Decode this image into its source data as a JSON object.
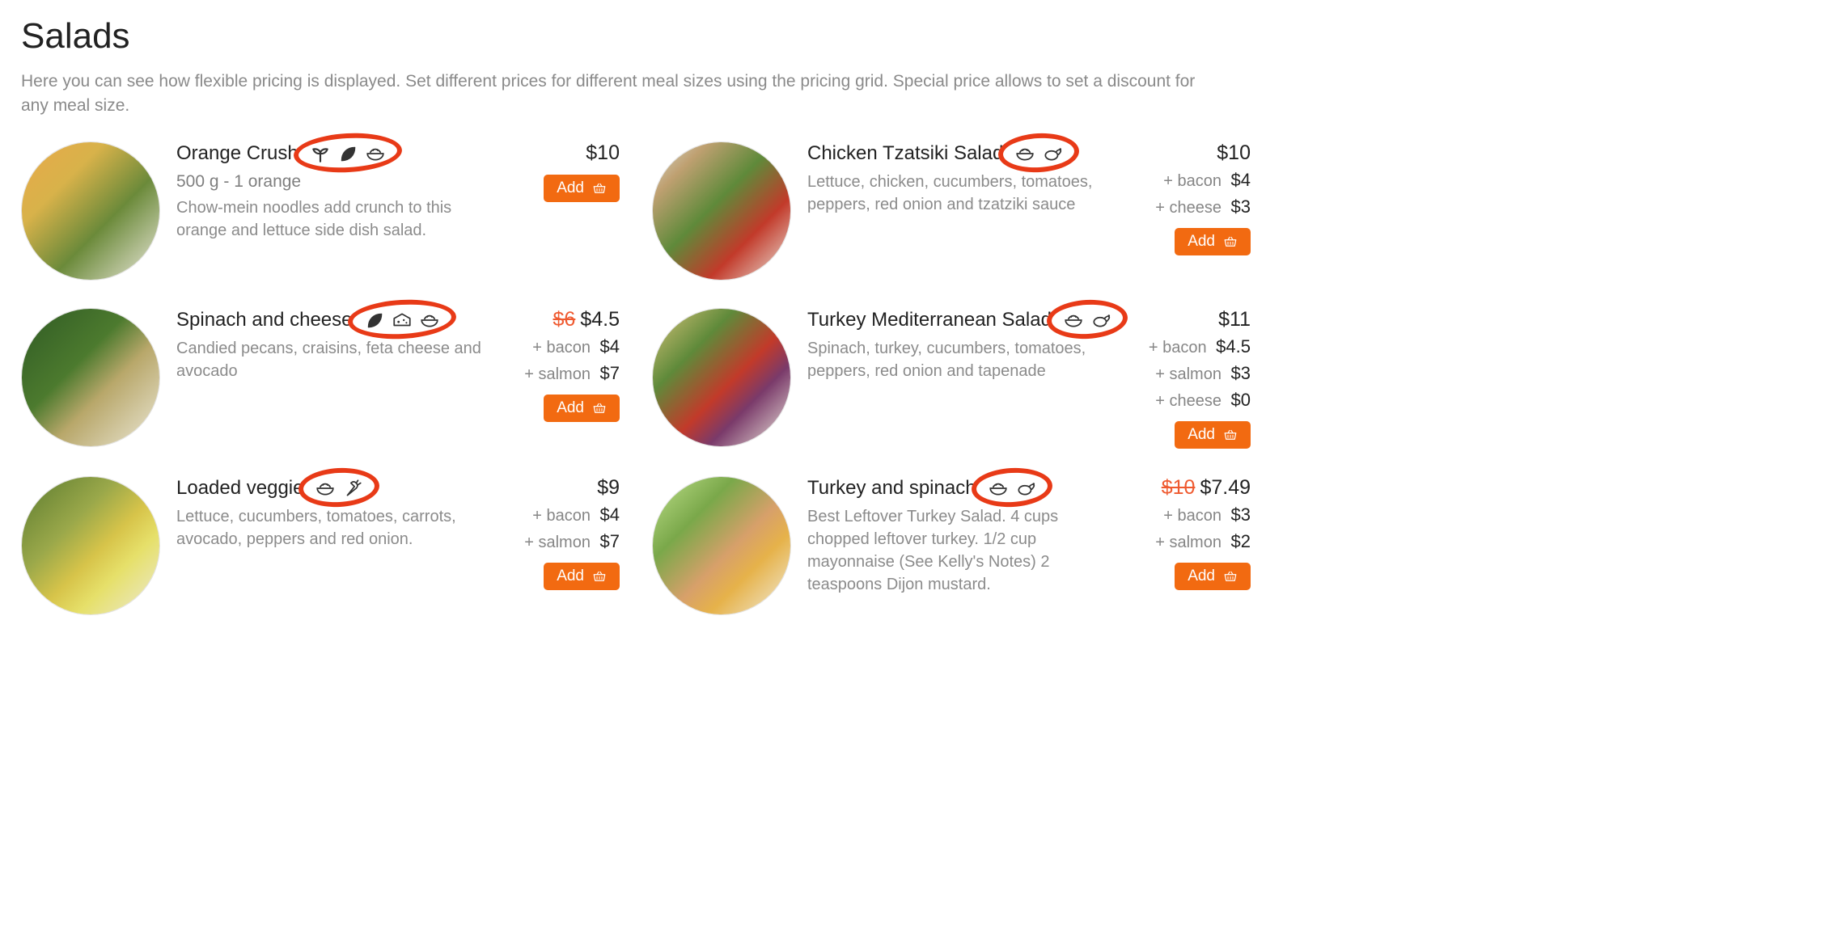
{
  "section": {
    "title": "Salads",
    "description": "Here you can see how flexible pricing is displayed. Set different prices for different meal sizes using the pricing grid. Special price allows to set a discount for any meal size."
  },
  "icons": {
    "sprout": "sprout-icon",
    "leaf": "leaf-icon",
    "bowl": "bowl-icon",
    "cheese": "cheese-icon",
    "carrot": "carrot-icon",
    "poultry": "poultry-icon"
  },
  "add_label": "Add",
  "items": [
    {
      "id": "orange-crush",
      "name": "Orange Crush",
      "desc": "Chow-mein noodles add crunch to this orange and lettuce side dish salad.",
      "icons": [
        "sprout",
        "leaf",
        "bowl"
      ],
      "note": "500 g - 1 orange",
      "price": "$10",
      "old_price": "",
      "addons": [],
      "swatch": "linear-gradient(135deg,#e9a94a 0%,#d8b24a 30%,#6b8a3a 60%,#eeeade 100%)"
    },
    {
      "id": "chicken-tzatsiki",
      "name": "Chicken Tzatsiki Salad",
      "desc": "Lettuce, chicken, cucumbers, tomatoes, peppers, red onion and tzatziki sauce",
      "icons": [
        "bowl",
        "poultry"
      ],
      "note": "",
      "price": "$10",
      "old_price": "",
      "addons": [
        {
          "label": "+ bacon",
          "price": "$4"
        },
        {
          "label": "+ cheese",
          "price": "$3"
        }
      ],
      "swatch": "linear-gradient(135deg,#d7dbcf 0%,#bfa071 20%,#5f8a3a 45%,#c23a2a 70%,#ecebe2 100%)"
    },
    {
      "id": "spinach-cheese",
      "name": "Spinach and cheese",
      "desc": "Candied pecans, craisins, feta cheese and avocado",
      "icons": [
        "leaf",
        "cheese",
        "bowl"
      ],
      "note": "",
      "price": "$4.5",
      "old_price": "$6",
      "addons": [
        {
          "label": "+ bacon",
          "price": "$4"
        },
        {
          "label": "+ salmon",
          "price": "$7"
        }
      ],
      "swatch": "linear-gradient(135deg,#2f5a24 0%,#4c7a2e 40%,#b8a76a 60%,#ece9d8 100%)"
    },
    {
      "id": "turkey-mediterranean",
      "name": "Turkey Mediterranean Salad",
      "desc": "Spinach, turkey, cucumbers, tomatoes, peppers, red onion and tapenade",
      "icons": [
        "bowl",
        "poultry"
      ],
      "note": "",
      "price": "$11",
      "old_price": "",
      "addons": [
        {
          "label": "+ bacon",
          "price": "$4.5"
        },
        {
          "label": "+ salmon",
          "price": "$3"
        },
        {
          "label": "+ cheese",
          "price": "$0"
        }
      ],
      "swatch": "linear-gradient(135deg,#d9c47a 0%,#5f8a3a 30%,#c23a2a 55%,#7a3a6a 70%,#f1eee0 100%)"
    },
    {
      "id": "loaded-veggie",
      "name": "Loaded veggie",
      "desc": "Lettuce, cucumbers, tomatoes, carrots, avocado, peppers and red onion.",
      "icons": [
        "bowl",
        "carrot"
      ],
      "note": "",
      "price": "$9",
      "old_price": "",
      "addons": [
        {
          "label": "+ bacon",
          "price": "$4"
        },
        {
          "label": "+ salmon",
          "price": "$7"
        }
      ],
      "swatch": "linear-gradient(135deg,#5a7a2e 0%,#9aa84a 35%,#d7c44a 55%,#e6e06a 70%,#ece9d8 100%)"
    },
    {
      "id": "turkey-spinach",
      "name": "Turkey and spinach",
      "desc": "Best Leftover Turkey Salad. 4 cups chopped leftover turkey. 1/2 cup mayonnaise (See Kelly's Notes) 2 teaspoons Dijon mustard.",
      "icons": [
        "bowl",
        "poultry"
      ],
      "note": "",
      "price": "$7.49",
      "old_price": "$10",
      "addons": [
        {
          "label": "+ bacon",
          "price": "$3"
        },
        {
          "label": "+ salmon",
          "price": "$2"
        }
      ],
      "swatch": "linear-gradient(135deg,#bfe08a 0%,#7aa84a 30%,#d7a06a 55%,#e6b24a 70%,#f1eee0 100%)"
    }
  ]
}
